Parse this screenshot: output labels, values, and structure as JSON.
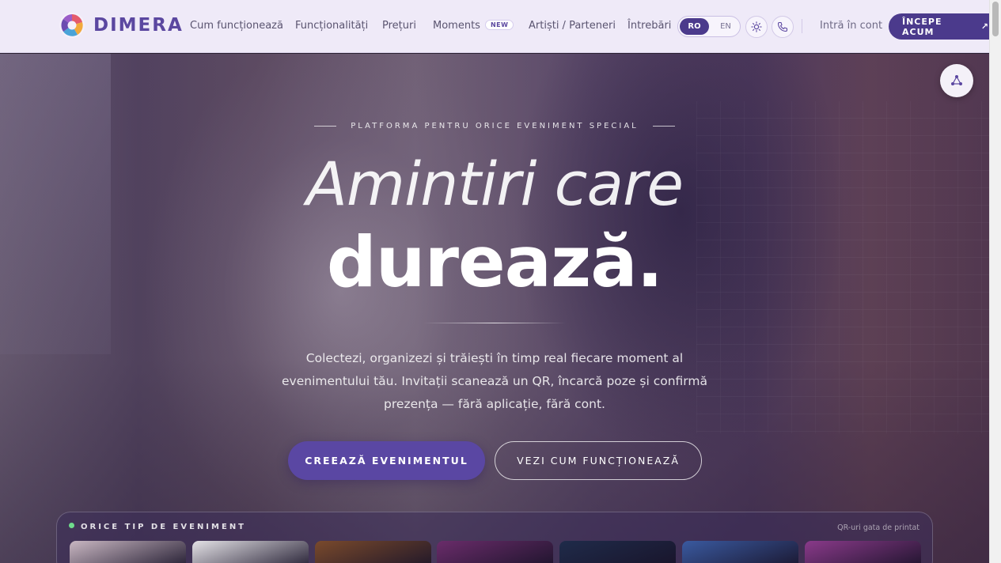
{
  "brand": {
    "name": "DIMERA"
  },
  "nav": {
    "links": [
      "Cum funcționează",
      "Funcționalități",
      "Prețuri",
      "Moments",
      "Artiști / Parteneri",
      "Întrebări"
    ],
    "moments_badge": "NEW",
    "lang_active": "RO",
    "lang_other": "EN",
    "login": "Intră în cont",
    "cta": "ÎNCEPE ACUM",
    "cta_arrow": "↗"
  },
  "hero": {
    "eyebrow": "PLATFORMA PENTRU ORICE EVENIMENT SPECIAL",
    "title_light": "Amintiri care",
    "title_bold": "durează.",
    "subtitle": "Colectezi, organizezi și trăiești în timp real fiecare moment al evenimentului tău. Invitații scanează un QR, încarcă poze și confirmă prezența — fără aplicație, fără cont.",
    "primary_cta": "CREEAZĂ EVENIMENTUL",
    "secondary_cta": "VEZI CUM FUNCȚIONEAZĂ"
  },
  "events": {
    "label": "ORICE TIP DE EVENIMENT",
    "hint": "QR-uri gata de printat",
    "thumbs": [
      {
        "color": "#c9b7c2"
      },
      {
        "color": "#e4e2e6"
      },
      {
        "color": "#7a4a2c"
      },
      {
        "color": "#6a2c6a"
      },
      {
        "color": "#1f2b4a"
      },
      {
        "color": "#3a5aa0"
      },
      {
        "color": "#8a3a8a"
      }
    ]
  },
  "icons": {
    "theme": "sun-icon",
    "phone": "phone-icon",
    "widget": "share-icon"
  }
}
